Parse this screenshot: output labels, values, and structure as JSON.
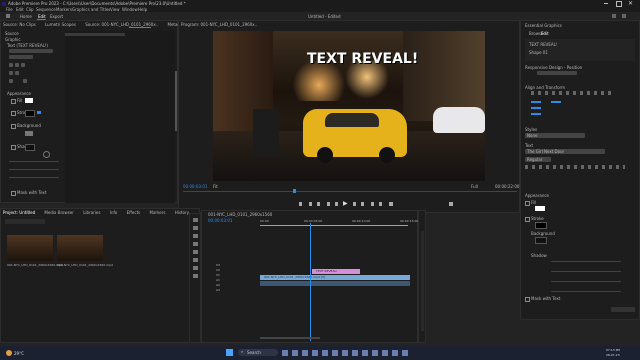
{
  "window": {
    "title": "Adobe Premiere Pro 2023 - C:\\Users\\User\\Documents\\Adobe\\Premiere Pro\\23.0\\Untitled *",
    "menu": [
      "File",
      "Edit",
      "Clip",
      "Sequence",
      "Markers",
      "Graphics and Titles",
      "View",
      "Window",
      "Help"
    ]
  },
  "workspace": {
    "tabs": [
      "Home",
      "Edit",
      "Export"
    ],
    "active": "Edit",
    "center_label": "Untitled - Edited"
  },
  "source_panel": {
    "tabs": [
      "Source: No Clips",
      "Lumetri Scopes",
      "Source: 001-NYC_LHD_0101_2960x..",
      "Metadata",
      "Effect Controls",
      "Audio Clip Mixer"
    ],
    "active_tab": "Effect Controls",
    "sections": [
      "Source",
      "Graphic",
      "Text (TEXT REVEAL!)",
      "Appearance",
      "Fill",
      "Stroke",
      "Background",
      "Shadow",
      "Mask with Text"
    ]
  },
  "program": {
    "title": "Program: 001-NYC_LHD_0101_2960x..",
    "overlay_text": "TEXT REVEAL!",
    "timecode_left": "00:00:03:01",
    "fit": "Fit",
    "quality": "Full",
    "timecode_right": "00:00:22:00"
  },
  "project_panel": {
    "tabs": [
      "Project: Untitled",
      "Media Browser",
      "Libraries",
      "Info",
      "Effects",
      "Markers",
      "History"
    ],
    "clips": [
      "001-NYC_LHD_0101_2960x1560.mp4",
      "001-NYC_LHD_0101_2960x1560.mp4"
    ]
  },
  "timeline": {
    "tab": "001-NYC_LHD_0101_2960x1560",
    "timecode": "00:00:03:01",
    "ruler": [
      "00:00",
      "00:00:05:00",
      "00:00:10:00",
      "00:00:15:00"
    ],
    "tracks": [
      "V3",
      "V2",
      "V1",
      "A1",
      "A2",
      "A3"
    ],
    "clips": {
      "graphic": "TEXT REVEAL!",
      "video": "001-NYC_LHD_0101_2960x1560.mp4 [V]"
    }
  },
  "essential_graphics": {
    "title": "Essential Graphics",
    "tabs": [
      "Browse",
      "Edit"
    ],
    "layers": [
      "TEXT REVEAL!",
      "Shape 01"
    ],
    "sections": [
      "Responsive Design - Position",
      "Align and Transform",
      "Styles",
      "Text",
      "Appearance",
      "Fill",
      "Stroke",
      "Background",
      "Shadow",
      "Mask with Text"
    ],
    "style_value": "None",
    "font": "The Girl Next Door",
    "font_style": "Regular",
    "mask_label": "Mask with Text"
  },
  "taskbar": {
    "search": "Search",
    "time": "07:13 PM",
    "date": "28-07-23",
    "weather": "29°C"
  },
  "colors": {
    "accent": "#2d8ceb",
    "clip_pink": "#d58fd8",
    "clip_blue": "#77a9d8",
    "clip_audio": "#3b5773"
  }
}
